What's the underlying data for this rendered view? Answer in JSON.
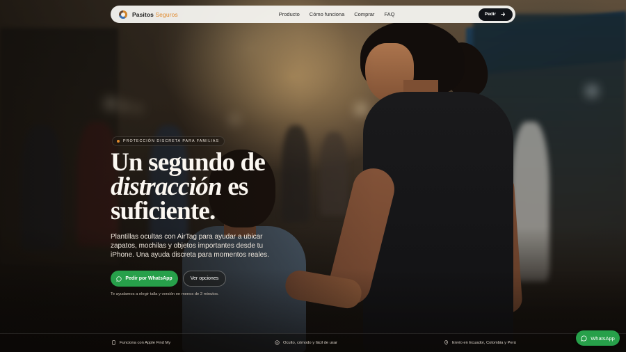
{
  "nav": {
    "brand_main": "Pasitos",
    "brand_accent": "Seguros",
    "links": [
      "Producto",
      "Cómo funciona",
      "Comprar",
      "FAQ"
    ],
    "cta_label": "Pedir"
  },
  "hero": {
    "eyebrow": "PROTECCIÓN DISCRETA PARA FAMILIAS",
    "headline_line1": "Un segundo de",
    "headline_italic": "distracción",
    "headline_line2_rest": " es",
    "headline_line3": "suficiente.",
    "subtitle": "Plantillas ocultas con AirTag para ayudar a ubicar zapatos, mochilas y objetos importantes desde tu iPhone. Una ayuda discreta para momentos reales.",
    "primary_button": "Pedir por WhatsApp",
    "secondary_button": "Ver opciones",
    "helper_text": "Te ayudamos a elegir talla y versión en menos de 2 minutos."
  },
  "features": [
    {
      "icon": "phone-icon",
      "label": "Funciona con Apple Find My"
    },
    {
      "icon": "check-circle-icon",
      "label": "Oculto, cómodo y fácil de usar"
    },
    {
      "icon": "location-pin-icon",
      "label": "Envío en Ecuador, Colombia y Perú"
    }
  ],
  "floating_button": {
    "label": "WhatsApp"
  },
  "colors": {
    "accent_orange": "#e0892c",
    "whatsapp_green": "#27a04a",
    "nav_bg": "#f4f2ee",
    "nav_cta_bg": "#101318"
  }
}
